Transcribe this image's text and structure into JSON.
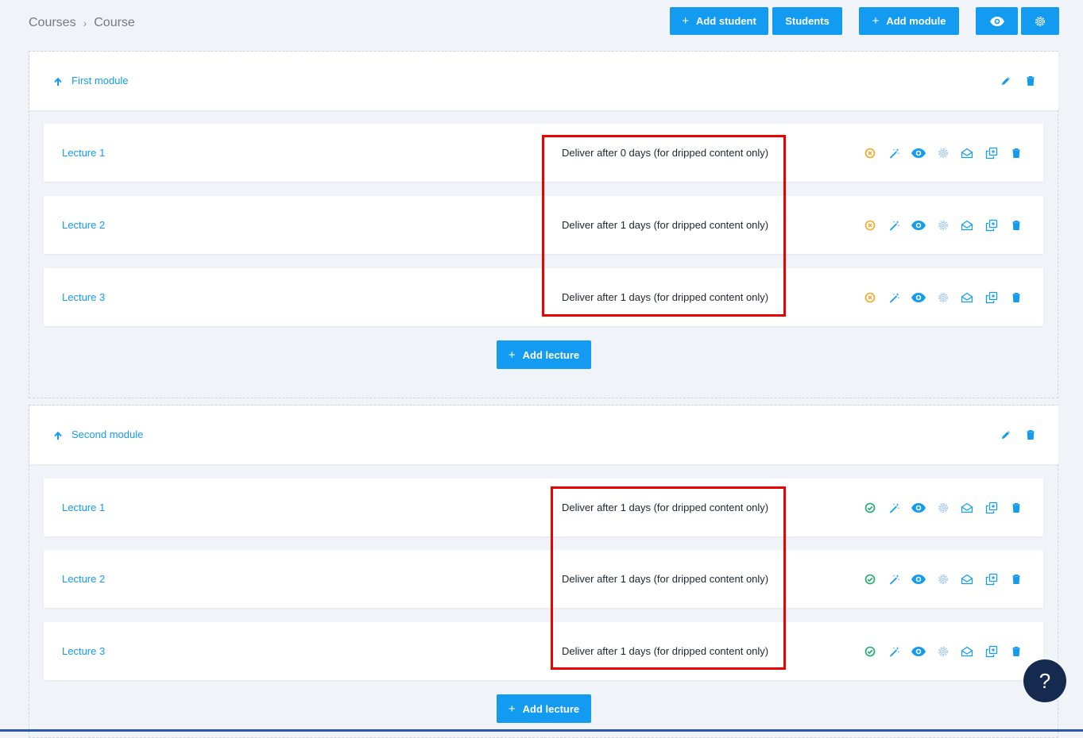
{
  "breadcrumb": {
    "root": "Courses",
    "separator": "›",
    "current": "Course"
  },
  "toolbar": {
    "add_student": "Add student",
    "students": "Students",
    "add_module": "Add module",
    "plus": "+"
  },
  "modules": [
    {
      "title": "First module",
      "add_lecture": "Add lecture",
      "lectures": [
        {
          "title": "Lecture 1",
          "deliver": "Deliver after 0 days (for dripped content only)",
          "status": "unpublished"
        },
        {
          "title": "Lecture 2",
          "deliver": "Deliver after 1 days (for dripped content only)",
          "status": "unpublished"
        },
        {
          "title": "Lecture 3",
          "deliver": "Deliver after 1 days (for dripped content only)",
          "status": "unpublished"
        }
      ]
    },
    {
      "title": "Second module",
      "add_lecture": "Add lecture",
      "lectures": [
        {
          "title": "Lecture 1",
          "deliver": "Deliver after 1 days (for dripped content only)",
          "status": "published"
        },
        {
          "title": "Lecture 2",
          "deliver": "Deliver after 1 days (for dripped content only)",
          "status": "published"
        },
        {
          "title": "Lecture 3",
          "deliver": "Deliver after 1 days (for dripped content only)",
          "status": "published"
        }
      ]
    }
  ],
  "help": {
    "label": "?"
  },
  "colors": {
    "accent": "#139bf1",
    "unpublished": "#f5a623",
    "published": "#1bab6c",
    "highlight": "#ef0000",
    "help_bg": "#152a4f"
  },
  "icons": [
    "arrow-up-icon",
    "pencil-icon",
    "trash-icon",
    "status-icon",
    "magic-wand-icon",
    "eye-icon",
    "gear-icon",
    "envelope-open-icon",
    "copy-icon"
  ]
}
